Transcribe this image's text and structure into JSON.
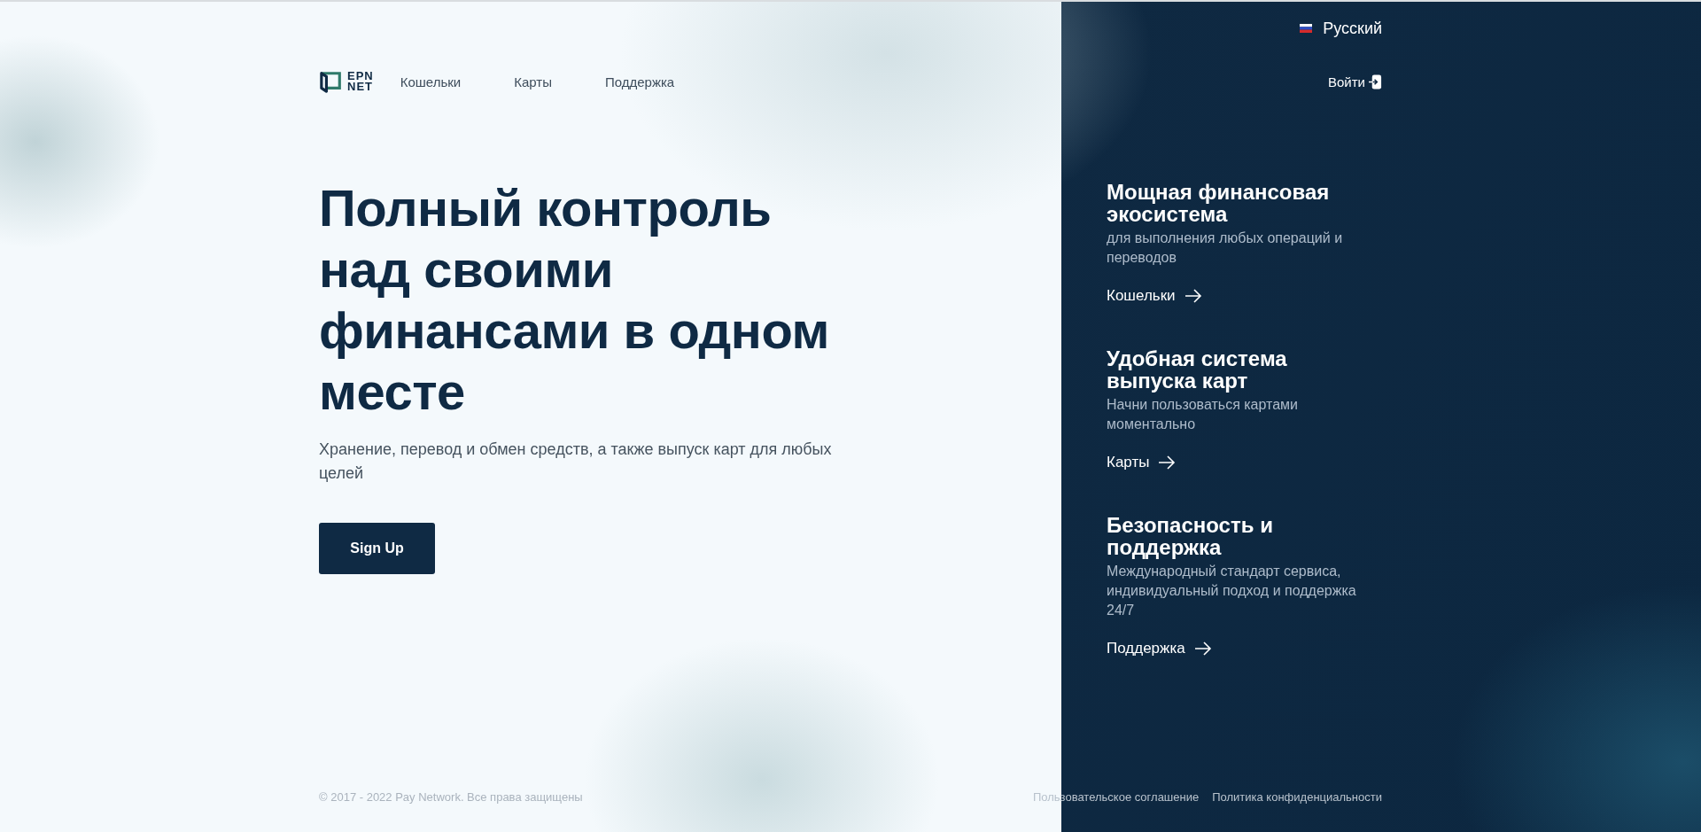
{
  "language": {
    "label": "Русский"
  },
  "header": {
    "logo": [
      "EPN",
      "NET"
    ],
    "links": [
      "Кошельки",
      "Карты",
      "Поддержка"
    ],
    "login": "Войти"
  },
  "hero": {
    "title": "Полный контроль над своими финансами в одном месте",
    "subtitle": "Хранение, перевод и обмен средств, а также выпуск карт для любых целей",
    "button": "Sign Up"
  },
  "features": [
    {
      "title": "Мощная финансовая экосистема",
      "description": "для выполнения любых операций и переводов",
      "link": "Кошельки"
    },
    {
      "title": "Удобная система выпуска карт",
      "description": "Начни пользоваться картами моментально",
      "link": "Карты"
    },
    {
      "title": "Безопасность и поддержка",
      "description": "Международный стандарт сервиса, индивидуальный подход и поддержка 24/7",
      "link": "Поддержка"
    }
  ],
  "footer": {
    "copyright": "© 2017 - 2022 Pay Network. Все права защищены",
    "links": [
      "Пользовательское соглашение",
      "Политика конфиденциальности"
    ]
  }
}
